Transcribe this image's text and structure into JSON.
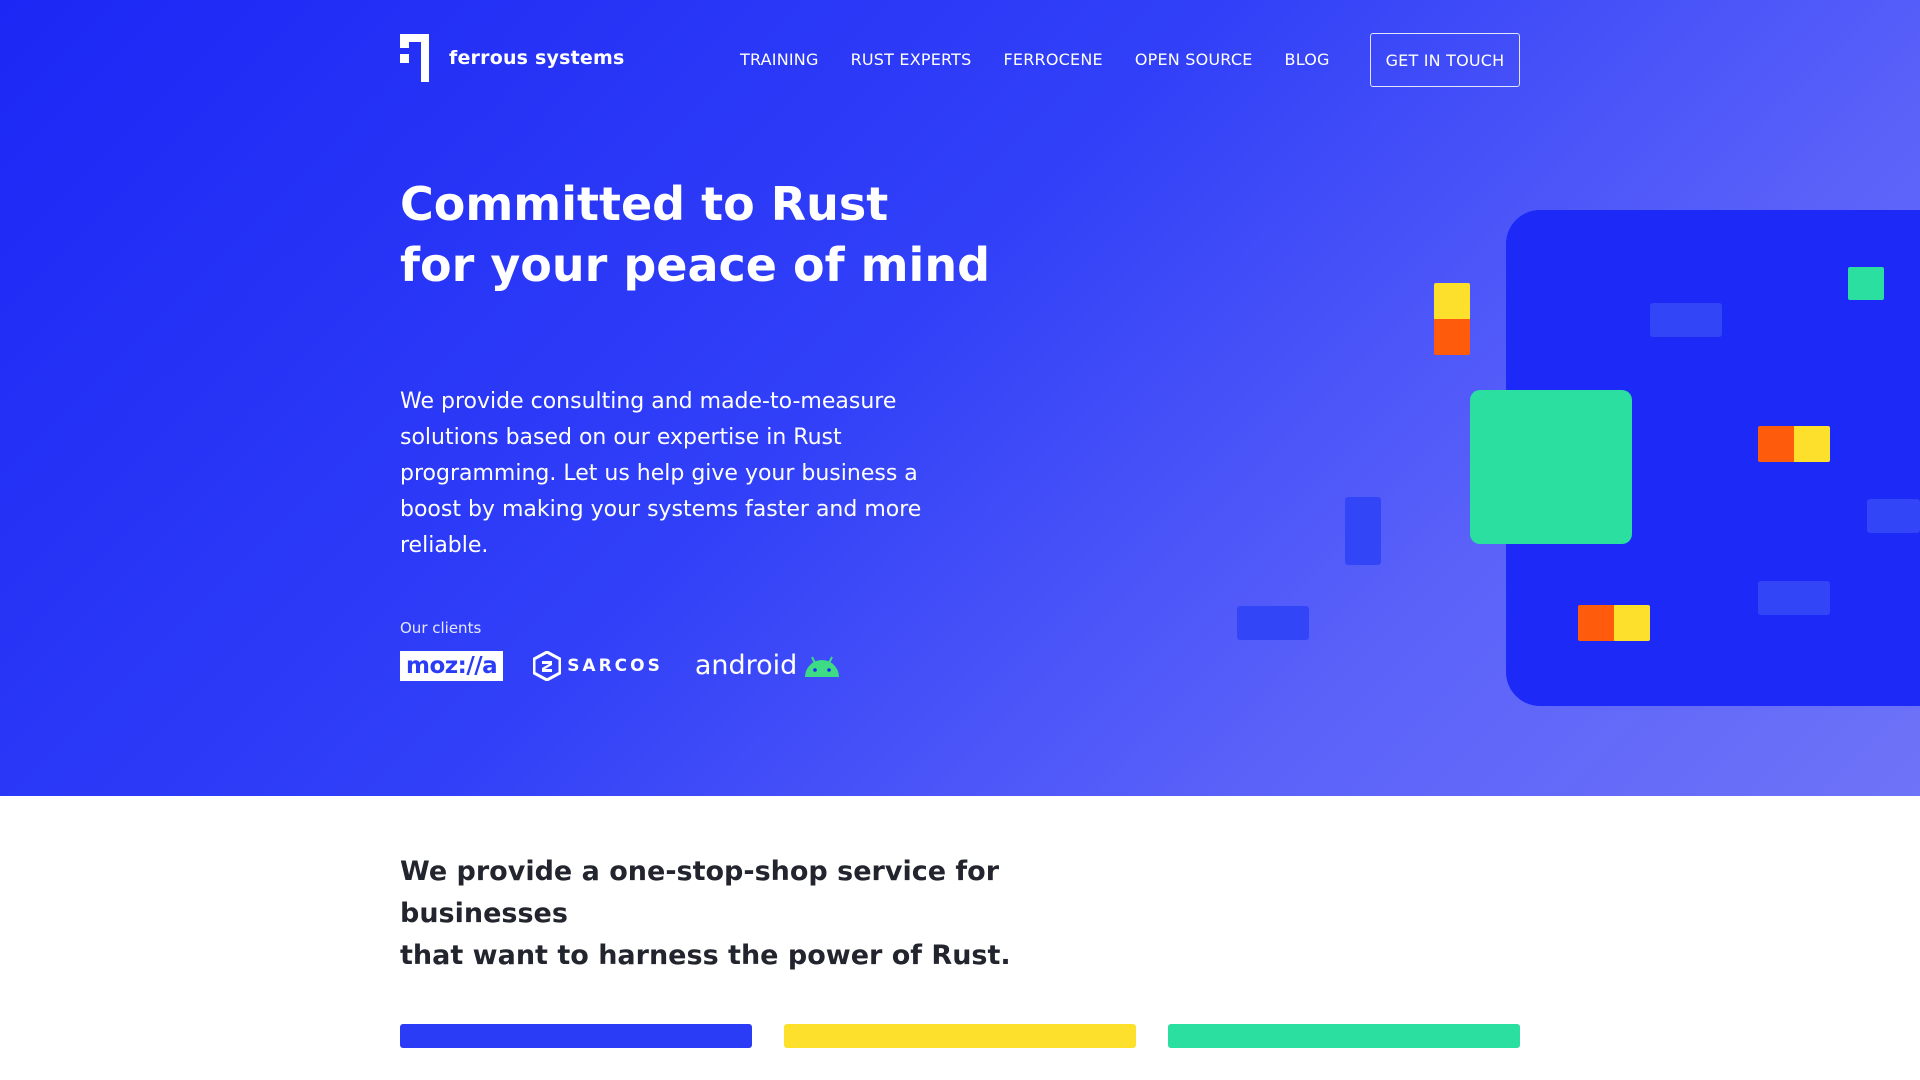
{
  "brand": {
    "name": "ferrous systems"
  },
  "nav": {
    "items": [
      "TRAINING",
      "RUST EXPERTS",
      "FERROCENE",
      "OPEN SOURCE",
      "BLOG"
    ],
    "cta_label": "GET IN TOUCH"
  },
  "hero": {
    "headline_line1": "Committed to Rust",
    "headline_line2": "for your peace of mind",
    "lead": "We provide consulting and made-to-measure solutions based on our expertise in Rust programming. Let us help give your business a boost by making your systems faster and more reliable.",
    "clients_label": "Our clients",
    "clients": {
      "mozilla": "moz://a",
      "sarcos": "SARCOS",
      "android": "android"
    }
  },
  "section": {
    "tagline_line1": "We provide a one-stop-shop service for businesses",
    "tagline_line2": "that want to harness the power of Rust."
  },
  "colors": {
    "hero_start": "#1c27f5",
    "hero_end": "#6e73f8",
    "accent_blue": "#2b3cf6",
    "accent_yellow": "#fde02c",
    "accent_green": "#2adf9f",
    "accent_orange": "#ff5b0d",
    "text_dark": "#23252e"
  },
  "icons": [
    "ferrous-logo-icon",
    "sarcos-logo-icon",
    "android-robot-icon"
  ]
}
